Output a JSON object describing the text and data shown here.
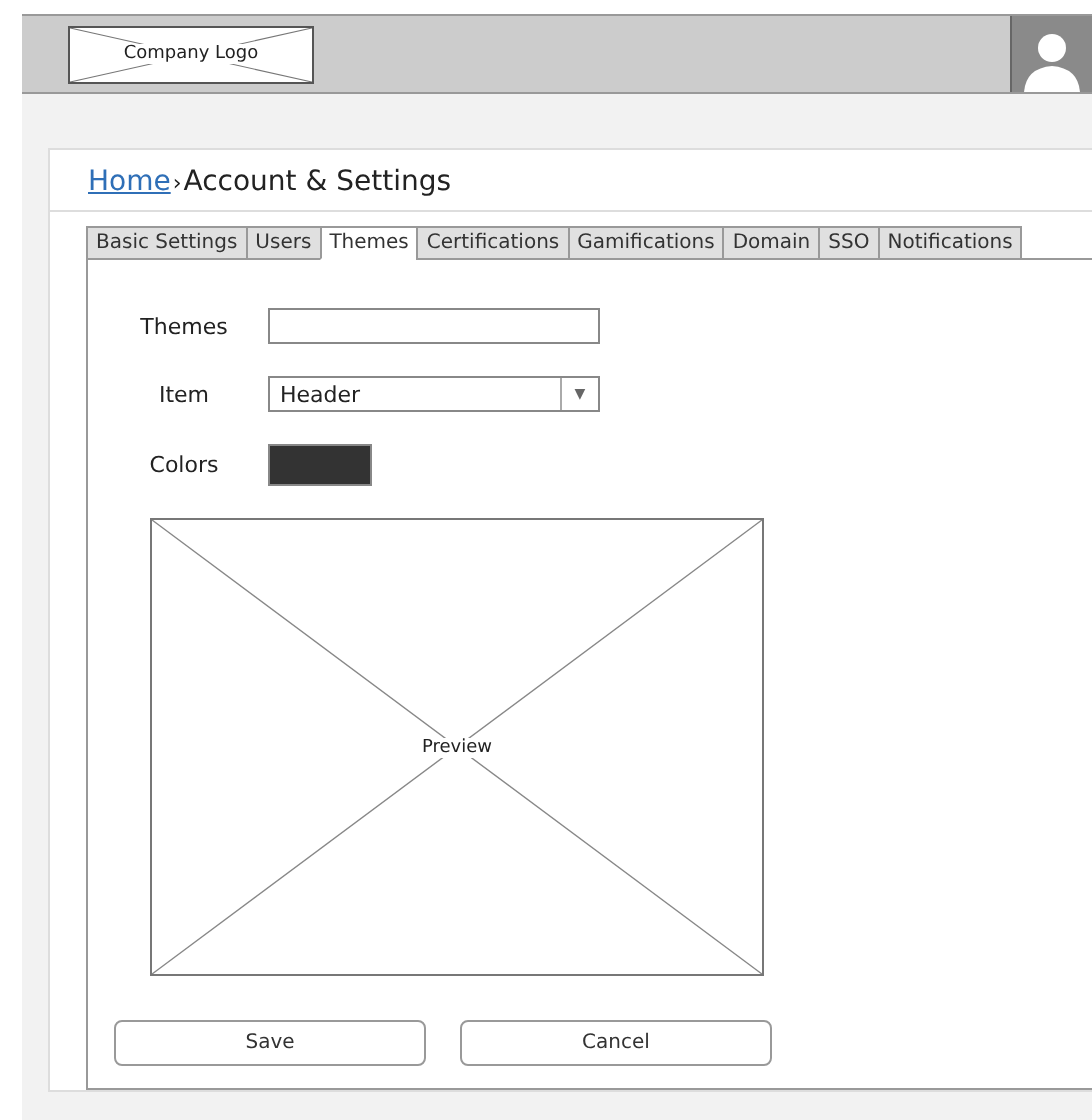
{
  "header": {
    "logo": "Company Logo"
  },
  "breadcrumb": {
    "link": "Home",
    "separator": "›",
    "current": "Account & Settings"
  },
  "tabs": [
    {
      "label": "Basic Settings",
      "selected": false
    },
    {
      "label": "Users",
      "selected": false
    },
    {
      "label": "Themes",
      "selected": true
    },
    {
      "label": "Certifications",
      "selected": false
    },
    {
      "label": "Gamifications",
      "selected": false
    },
    {
      "label": "Domain",
      "selected": false
    },
    {
      "label": "SSO",
      "selected": false
    },
    {
      "label": "Notifications",
      "selected": false
    }
  ],
  "form": {
    "themes_label": "Themes",
    "item_label": "Item",
    "item_value": "Header",
    "item_caret": "▼",
    "colors_label": "Colors",
    "color": "#333333"
  },
  "preview": {
    "label": "Preview"
  },
  "buttons": [
    "Save",
    "Cancel"
  ]
}
